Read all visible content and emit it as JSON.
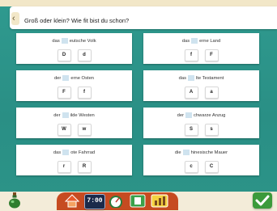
{
  "question": {
    "arrow_glyph": "‹",
    "text": "Groß oder klein? Wie fit bist du schon?"
  },
  "cards": [
    {
      "before": "das",
      "after": "eutsche Volk",
      "options": [
        "D",
        "d"
      ]
    },
    {
      "before": "das",
      "after": "erne Land",
      "options": [
        "f",
        "F"
      ]
    },
    {
      "before": "der",
      "after": "erne Osten",
      "options": [
        "F",
        "f"
      ]
    },
    {
      "before": "das",
      "after": "lte Testament",
      "options": [
        "A",
        "a"
      ]
    },
    {
      "before": "der",
      "after": "ilde Westen",
      "options": [
        "W",
        "w"
      ]
    },
    {
      "before": "der",
      "after": "chwarze Anzug",
      "options": [
        "S",
        "s"
      ]
    },
    {
      "before": "das",
      "after": "ote Fahrrad",
      "options": [
        "r",
        "R"
      ]
    },
    {
      "before": "die",
      "after": "hinesische Mauer",
      "options": [
        "c",
        "C"
      ]
    }
  ],
  "toolbar": {
    "time_display": "7:00",
    "icons": [
      "home-icon",
      "clock-icon",
      "gauge-icon",
      "book-icon",
      "bars-icon"
    ]
  },
  "colors": {
    "background": "#2f9a8f",
    "toolbar": "#c64b21",
    "confirm": "#3b9a3b"
  }
}
